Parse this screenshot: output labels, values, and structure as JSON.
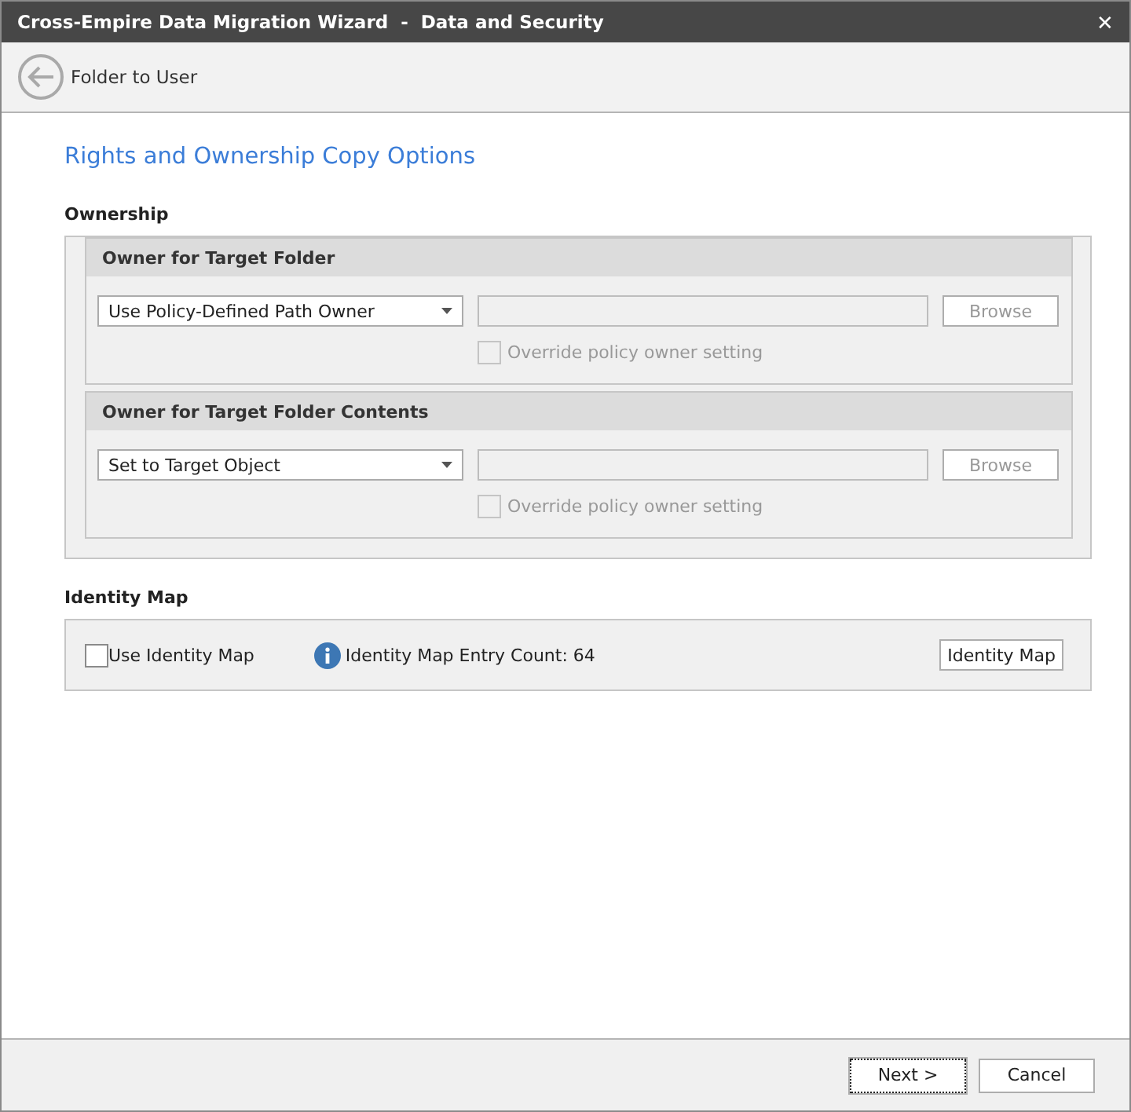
{
  "window": {
    "title": "Cross-Empire Data Migration Wizard  -  Data and Security",
    "close": "✕"
  },
  "nav": {
    "back_label": "Folder to User"
  },
  "page_title": "Rights and Ownership Copy Options",
  "ownership": {
    "label": "Ownership",
    "groups": [
      {
        "title": "Owner for Target Folder",
        "dropdown": "Use Policy-Defined Path Owner",
        "browse": "Browse",
        "override": {
          "label": "Override policy owner setting",
          "checked": false,
          "disabled": true
        }
      },
      {
        "title": "Owner for Target Folder Contents",
        "dropdown": "Set to Target Object",
        "browse": "Browse",
        "override": {
          "label": "Override policy owner setting",
          "checked": false,
          "disabled": true
        }
      }
    ]
  },
  "identity_map": {
    "label": "Identity Map",
    "use": {
      "label": "Use Identity Map",
      "checked": false,
      "disabled": false
    },
    "count": "Identity Map Entry Count: 64",
    "button": "Identity Map"
  },
  "buttons": [
    {
      "label": "Next >",
      "focused": true
    },
    {
      "label": "Cancel",
      "focused": false
    }
  ]
}
